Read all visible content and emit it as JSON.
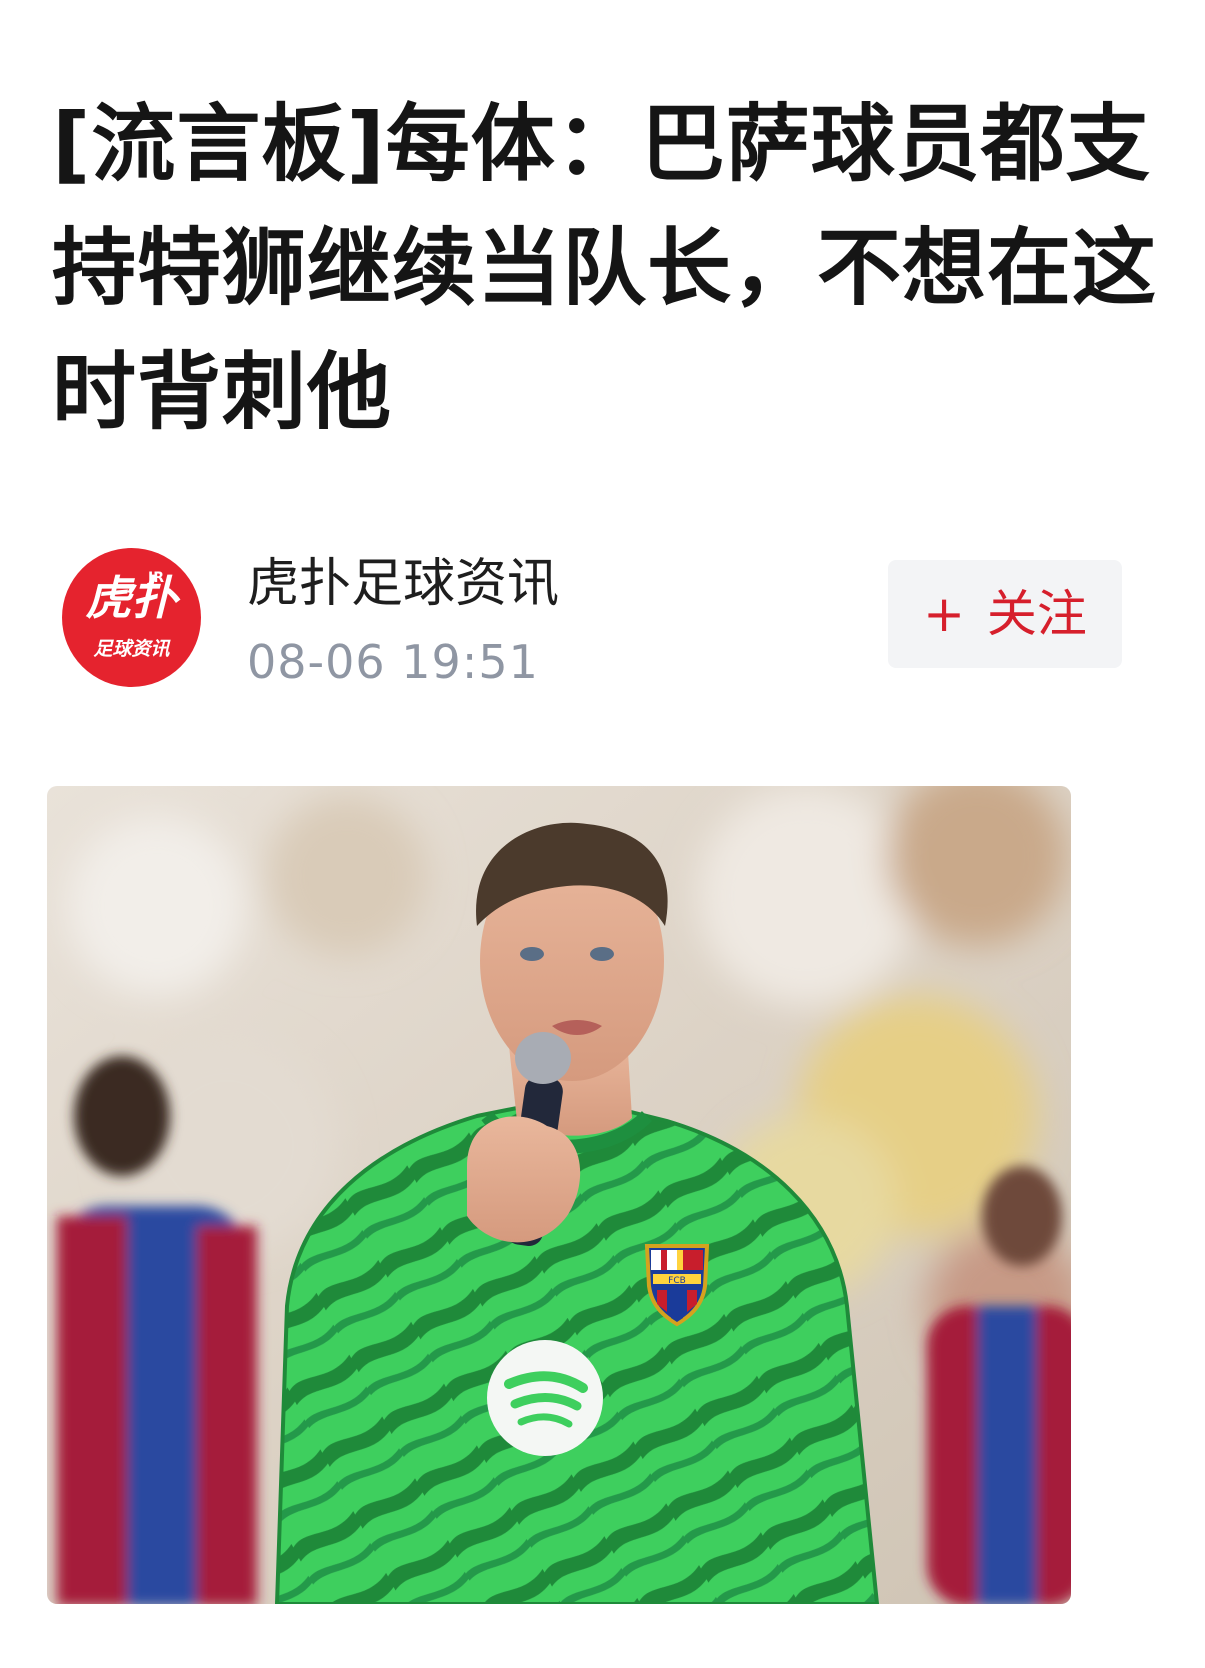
{
  "article": {
    "title": "[流言板]每体：巴萨球员都支持特狮继续当队长，不想在这时背刺他"
  },
  "author": {
    "name": "虎扑足球资讯",
    "time": "08-06 19:51",
    "avatar_main": "虎扑",
    "avatar_tag": "JR",
    "avatar_sub": "足球资讯"
  },
  "follow_button": {
    "icon": "plus-icon",
    "label": "关注"
  },
  "photo": {
    "crest_text": "FCB"
  },
  "colors": {
    "brand_red": "#e5232e",
    "follow_text": "#d61f2c",
    "time_gray": "#8f96a3",
    "jersey_green": "#3ecf5e"
  }
}
